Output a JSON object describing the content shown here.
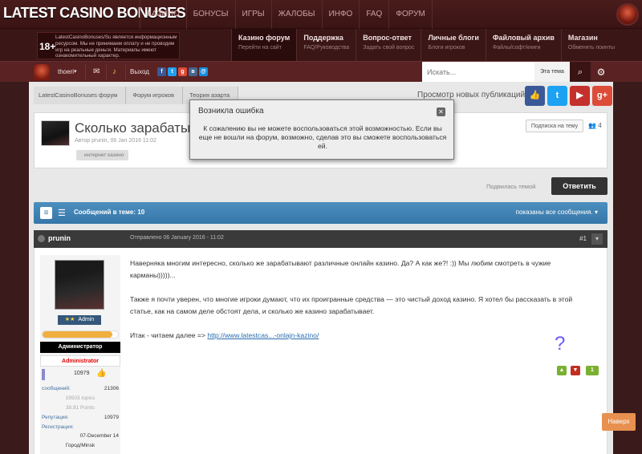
{
  "site": {
    "logo": "LATEST CASINO BONUSES",
    "nav": [
      "КАЗИНО",
      "БОНУСЫ",
      "ИГРЫ",
      "ЖАЛОБЫ",
      "ИНФО",
      "FAQ",
      "ФОРУМ"
    ]
  },
  "promo": {
    "age": "18+",
    "text": "LatestCasinoBonuses/Su является информационным ресурсом. Мы не принимаем оплату и не проводим игр на реальные деньги. Материалы имеют ознакомительный характер."
  },
  "subnav": [
    {
      "title": "Казино форум",
      "sub": "Перейти на сайт"
    },
    {
      "title": "Поддержка",
      "sub": "FAQ/Руководства"
    },
    {
      "title": "Вопрос-ответ",
      "sub": "Задать свой вопрос"
    },
    {
      "title": "Личные блоги",
      "sub": "Блоги игроков"
    },
    {
      "title": "Файловый архив",
      "sub": "Файлы/софт/книги"
    },
    {
      "title": "Магазин",
      "sub": "Обменять поинты"
    }
  ],
  "userbar": {
    "username": "thoeri",
    "logout": "Выход",
    "search_placeholder": "Искать...",
    "search_scope": "Эта тема"
  },
  "breadcrumbs": [
    "LatestCasinoBonuses форум",
    "Форум игроков",
    "Теория азарта"
  ],
  "new_posts": "Просмотр новых публикаций",
  "topic": {
    "title": "Сколько зарабатывает",
    "meta": "Автор prunin, 06 Jan 2016 11:02",
    "tag": "интернет казино",
    "follow_button": "Подписка на тему",
    "followers": "4"
  },
  "actions": {
    "follow_link": "Подвилась темой",
    "reply": "Ответить"
  },
  "bluebar": {
    "count": "Сообщений в теме: 10",
    "shown": "показаны все сообщения."
  },
  "post": {
    "author": "prunin",
    "date": "Отправлено 06 January 2016 - 11:02",
    "number": "#1",
    "rank": "Admin",
    "rank_stars": "★★",
    "reputation_fill": 0.93,
    "group1": "Администратор",
    "group2": "Administrator",
    "rep_value": "10979",
    "stats": {
      "posts_label": "сообщений:",
      "posts_value": "21306",
      "topics": "19503 topics",
      "points": "38.81 Points",
      "rep_label": "Репутация:",
      "rep_value": "10979",
      "reg_label": "Регистрация:",
      "reg_value": "07-December 14",
      "city": "Город/Minsk"
    },
    "paragraphs": [
      "Наверняка многим интересно, сколько же зарабатывают различные онлайн казино. Да? А как же?! :)) Мы любим смотреть в чужие карманы)))))...",
      "Также я почти уверен, что многие игроки думают, что их проигранные средства — это чистый доход казино. Я хотел бы рассказать в этой статье, как на самом деле обстоят дела, и сколько же казино зарабатывает."
    ],
    "readmore_prefix": "Итак - читаем далее => ",
    "readmore_link": "http://www.latestcas...-onlajn-kazino/",
    "qmark": "?",
    "up_button": "Наверх"
  },
  "modal": {
    "title": "Возникла ошибка",
    "message": "К сожалению вы не можете воспользоваться этой возможностью. Если вы еще не вошли на форум, возможно, сделав это вы сможете воспользоваться ей."
  },
  "colors": {
    "header": "#4a1c1c",
    "bluebar": "#3676a8",
    "reply": "#333333",
    "facebook": "#3b5998",
    "twitter": "#1da1f2",
    "youtube": "#c4302b",
    "gplus": "#dd4b39"
  }
}
